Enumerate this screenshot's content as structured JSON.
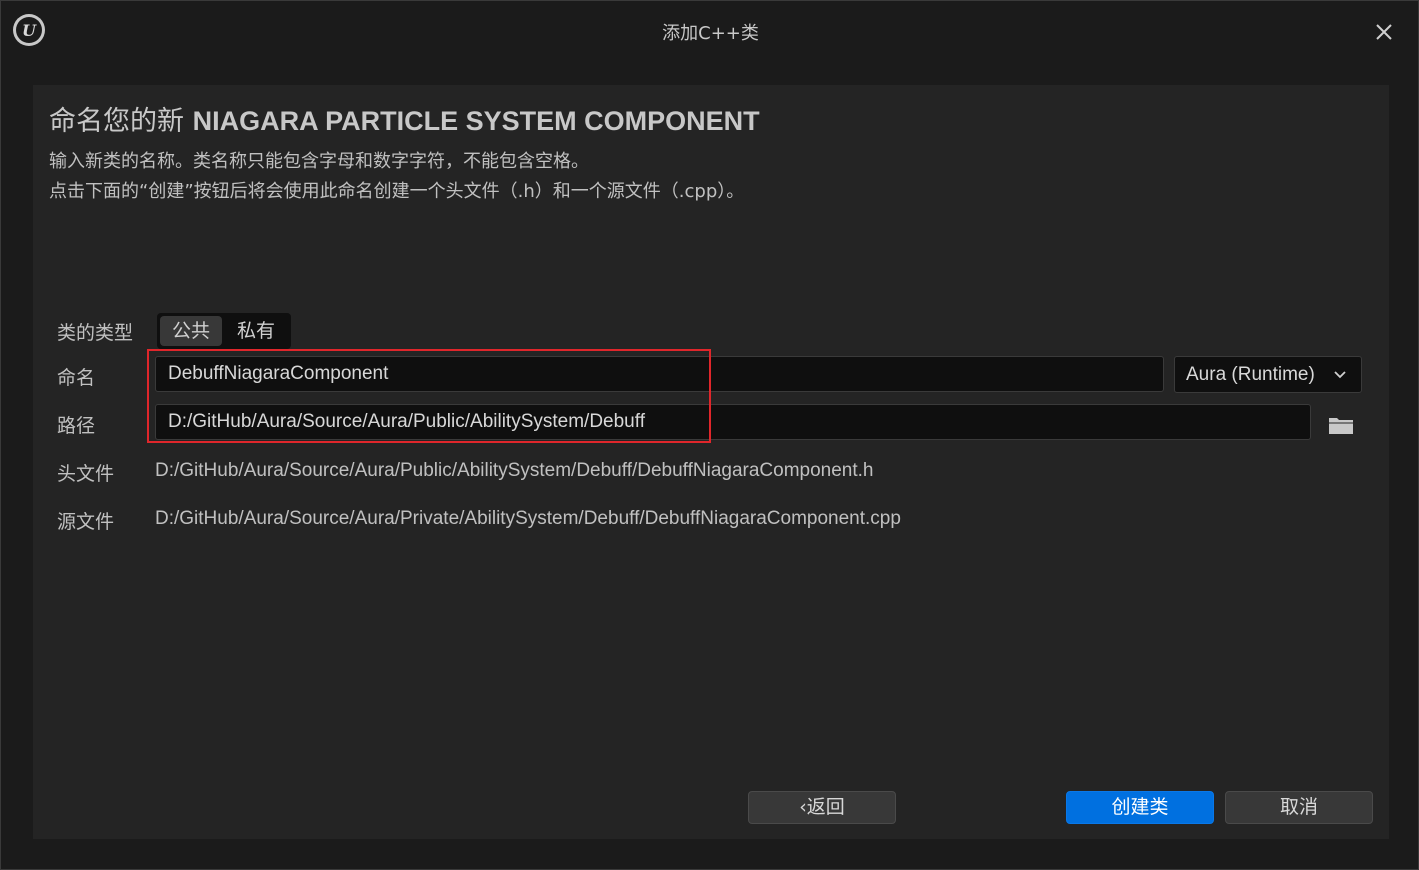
{
  "window": {
    "title": "添加C++类",
    "logo_icon": "unreal-logo-icon",
    "close_icon": "close-icon"
  },
  "header": {
    "heading_prefix": "命名您的新",
    "class_name": "NIAGARA PARTICLE SYSTEM COMPONENT",
    "desc_line1": "输入新类的名称。类名称只能包含字母和数字字符，不能包含空格。",
    "desc_line2": "点击下面的“创建”按钮后将会使用此命名创建一个头文件（.h）和一个源文件（.cpp）。"
  },
  "form": {
    "class_type_label": "类的类型",
    "class_type_options": [
      "公共",
      "私有"
    ],
    "class_type_selected": "公共",
    "name_label": "命名",
    "name_value": "DebuffNiagaraComponent",
    "module_value": "Aura (Runtime)",
    "path_label": "路径",
    "path_value": "D:/GitHub/Aura/Source/Aura/Public/AbilitySystem/Debuff",
    "header_file_label": "头文件",
    "header_file_value": "D:/GitHub/Aura/Source/Aura/Public/AbilitySystem/Debuff/DebuffNiagaraComponent.h",
    "source_file_label": "源文件",
    "source_file_value": "D:/GitHub/Aura/Source/Aura/Private/AbilitySystem/Debuff/DebuffNiagaraComponent.cpp"
  },
  "buttons": {
    "back_label": "返回",
    "create_label": "创建类",
    "cancel_label": "取消"
  },
  "colors": {
    "accent": "#0070e0",
    "highlight_border": "#e0262b"
  }
}
